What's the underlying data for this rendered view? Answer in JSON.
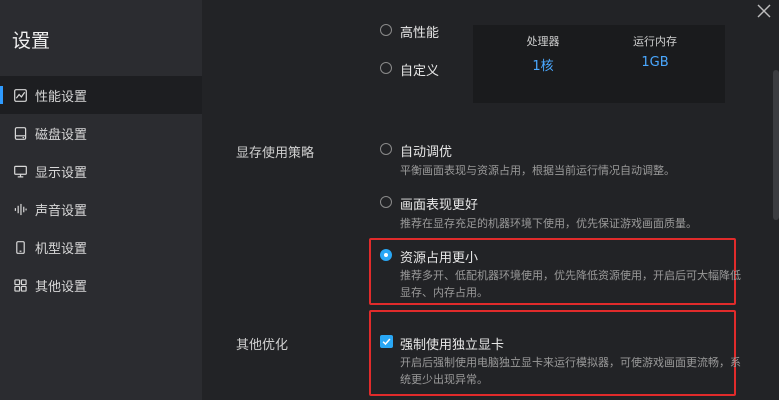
{
  "app": {
    "title": "设置"
  },
  "sidebar": {
    "items": [
      {
        "label": "性能设置",
        "icon": "performance-chart-icon"
      },
      {
        "label": "磁盘设置",
        "icon": "disk-icon"
      },
      {
        "label": "显示设置",
        "icon": "monitor-icon"
      },
      {
        "label": "声音设置",
        "icon": "sound-wave-icon"
      },
      {
        "label": "机型设置",
        "icon": "phone-icon"
      },
      {
        "label": "其他设置",
        "icon": "grid-icon"
      }
    ],
    "active_index": 0
  },
  "performance": {
    "mode_options": [
      {
        "label": "高性能",
        "checked": false
      },
      {
        "label": "自定义",
        "checked": false
      }
    ],
    "info": {
      "cpu_label": "处理器",
      "cpu_value": "1核",
      "ram_label": "运行内存",
      "ram_value": "1GB"
    }
  },
  "memory_strategy": {
    "section_label": "显存使用策略",
    "options": [
      {
        "label": "自动调优",
        "desc": "平衡画面表现与资源占用，根据当前运行情况自动调整。",
        "checked": false
      },
      {
        "label": "画面表现更好",
        "desc": "推荐在显存充足的机器环境下使用，优先保证游戏画面质量。",
        "checked": false
      },
      {
        "label": "资源占用更小",
        "desc_line1": "推荐多开、低配机器环境使用，优先降低资源使用，开启后可大幅降低",
        "desc_line2": "显存、内存占用。",
        "checked": true
      }
    ]
  },
  "other": {
    "section_label": "其他优化",
    "force_gpu": {
      "label": "强制使用独立显卡",
      "desc_line1": "开启后强制使用电脑独立显卡来运行模拟器，可使游戏画面更流畅，系",
      "desc_line2": "统更少出现异常。",
      "checked": true
    }
  },
  "colors": {
    "accent": "#29a7f5",
    "highlight": "#e12b2b",
    "info_value": "#4aa8ff"
  }
}
